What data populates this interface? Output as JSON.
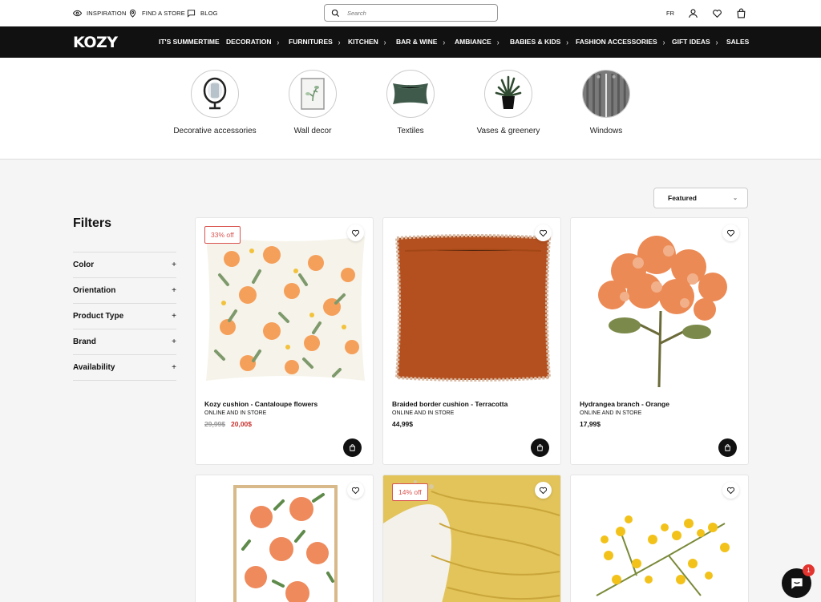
{
  "topbar": {
    "inspiration": "INSPIRATION",
    "find_store": "FIND A STORE",
    "blog": "BLOG",
    "search_placeholder": "Search",
    "lang": "FR"
  },
  "nav": {
    "logo": "KOZY",
    "items": [
      "IT'S SUMMERTIME",
      "DECORATION",
      "FURNITURES",
      "KITCHEN",
      "BAR & WINE",
      "AMBIANCE",
      "BABIES & KIDS",
      "FASHION ACCESSORIES",
      "GIFT IDEAS",
      "SALES"
    ]
  },
  "categories": [
    {
      "label": "Decorative accessories",
      "icon": "mirror-icon"
    },
    {
      "label": "Wall decor",
      "icon": "frame-icon"
    },
    {
      "label": "Textiles",
      "icon": "pillow-icon"
    },
    {
      "label": "Vases & greenery",
      "icon": "plant-icon"
    },
    {
      "label": "Windows",
      "icon": "curtain-icon"
    }
  ],
  "sort": {
    "selected": "Featured"
  },
  "filters": {
    "title": "Filters",
    "items": [
      "Color",
      "Orientation",
      "Product Type",
      "Brand",
      "Availability"
    ]
  },
  "products": [
    {
      "name": "Kozy cushion - Cantaloupe flowers",
      "availability": "ONLINE AND IN STORE",
      "old_price": "29,99$",
      "price": "20,00$",
      "badge": "33% off"
    },
    {
      "name": "Braided border cushion - Terracotta",
      "availability": "ONLINE AND IN STORE",
      "price": "44,99$"
    },
    {
      "name": "Hydrangea branch - Orange",
      "availability": "ONLINE AND IN STORE",
      "price": "17,99$"
    },
    {
      "badge": ""
    },
    {
      "badge": "14% off"
    },
    {
      "badge": ""
    }
  ],
  "chat": {
    "unread": "1"
  },
  "colors": {
    "accent": "#111111",
    "sale": "#c9302c",
    "badge_border": "#d9534f"
  }
}
